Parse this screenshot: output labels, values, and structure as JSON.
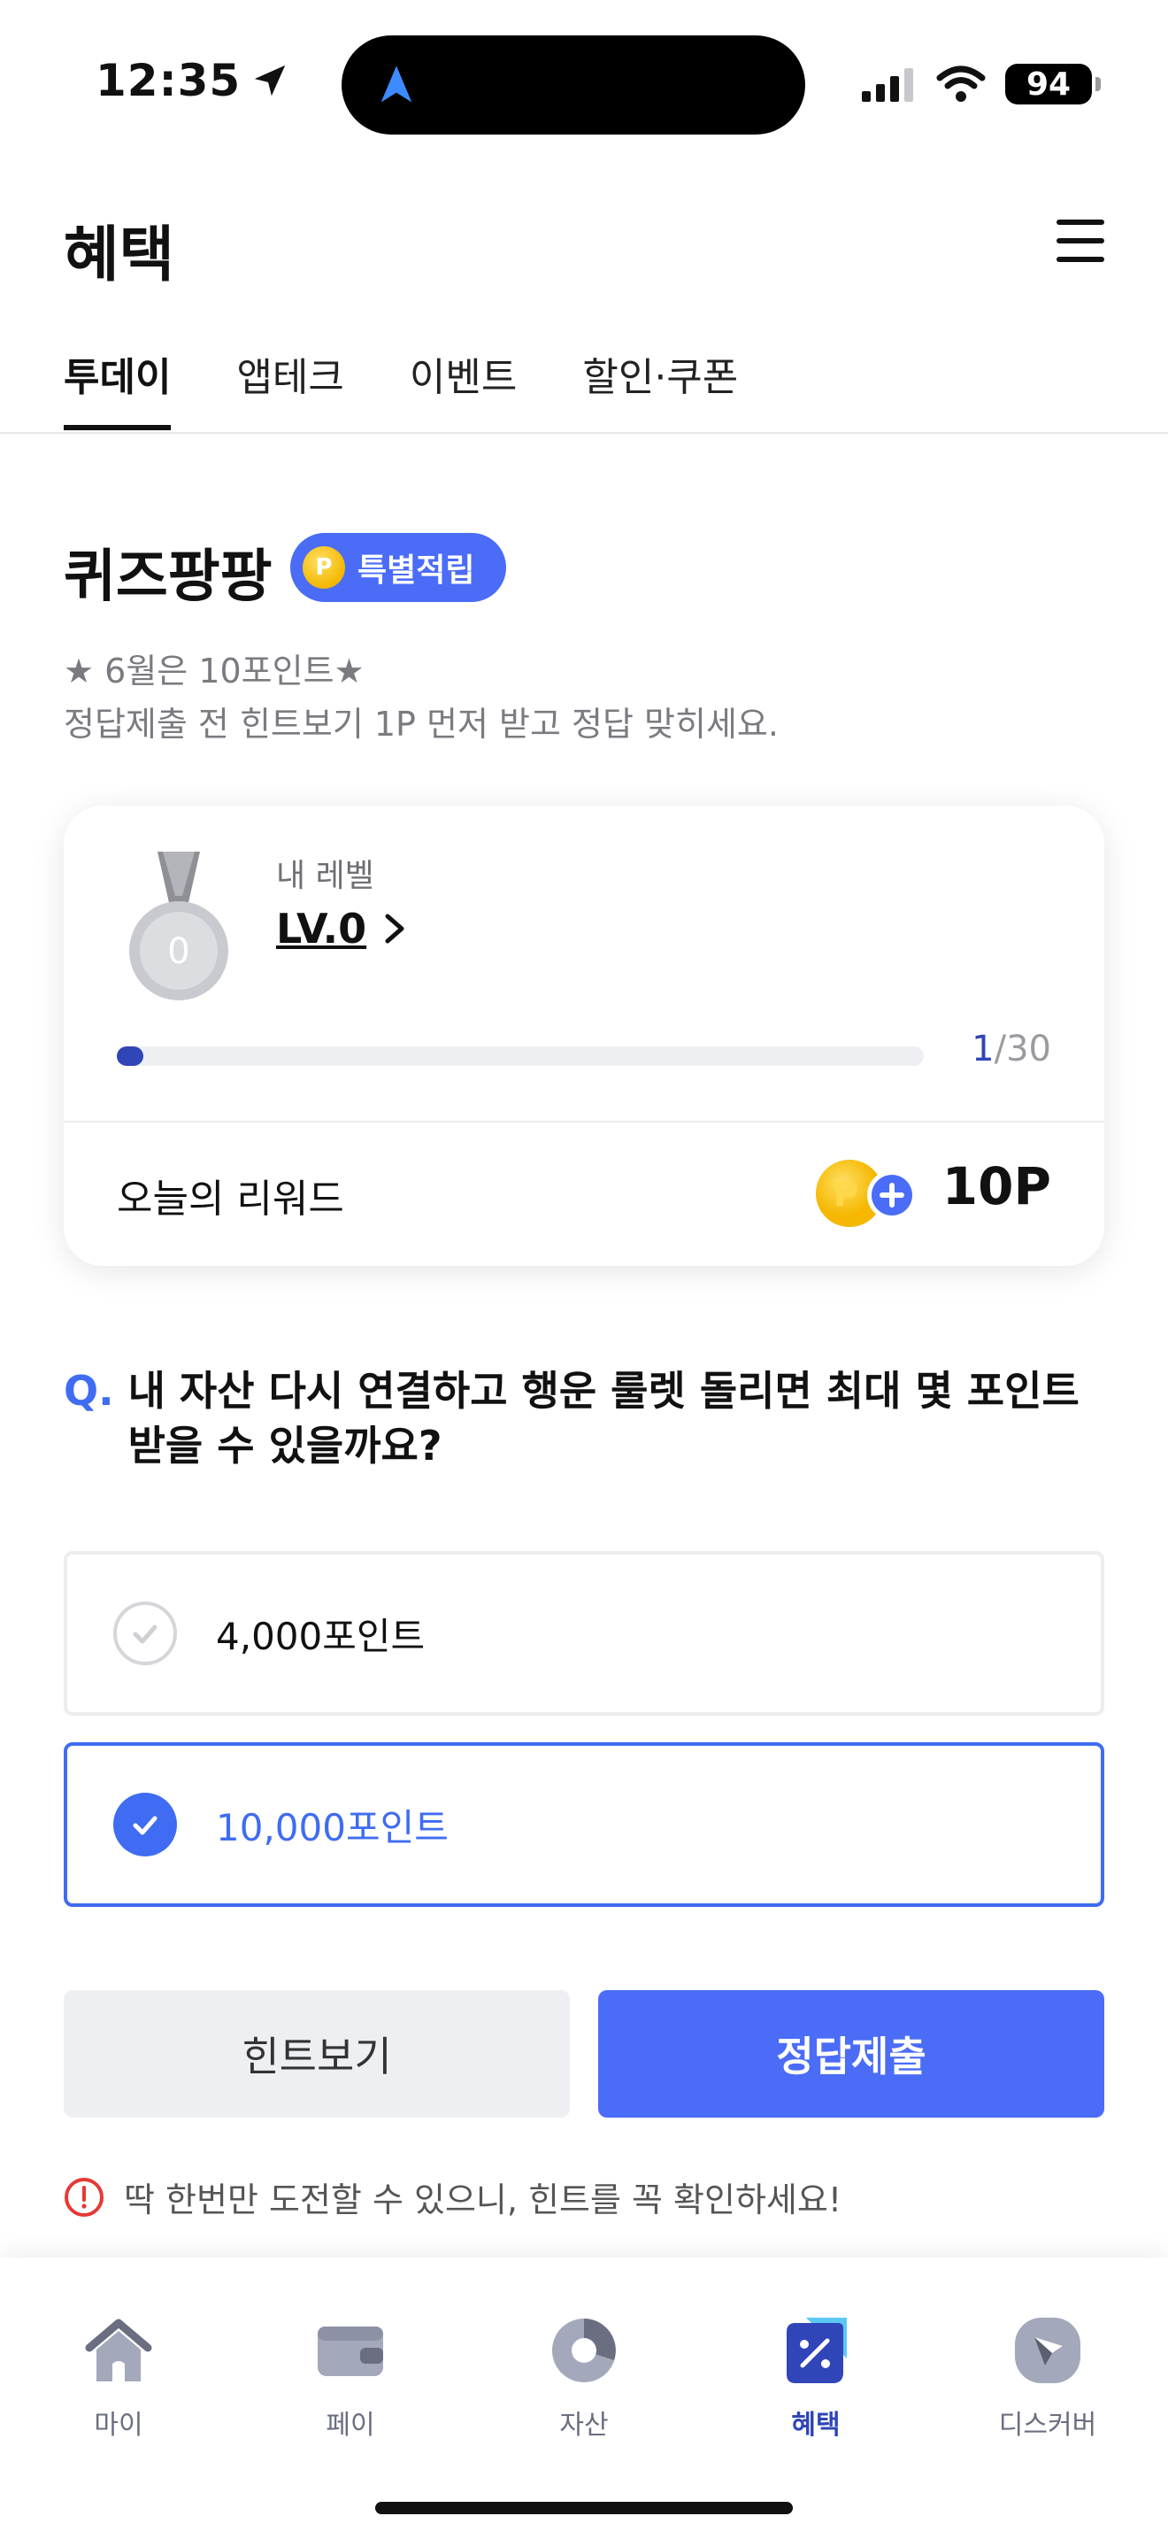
{
  "status_bar": {
    "time": "12:35",
    "battery": "94"
  },
  "header": {
    "title": "혜택"
  },
  "tabs": [
    {
      "label": "투데이",
      "active": true
    },
    {
      "label": "앱테크",
      "active": false
    },
    {
      "label": "이벤트",
      "active": false
    },
    {
      "label": "할인·쿠폰",
      "active": false
    }
  ],
  "quiz": {
    "title": "퀴즈팡팡",
    "badge": "특별적립",
    "badge_coin": "P",
    "desc_line1": "★ 6월은 10포인트★",
    "desc_line2": "정답제출 전 힌트보기 1P 먼저 받고 정답 맞히세요."
  },
  "level_card": {
    "caption": "내 레벨",
    "level": "LV.0",
    "medal_number": "0",
    "progress_current": "1",
    "progress_total": "/30",
    "progress_fraction": 0.0333,
    "reward_label": "오늘의 리워드",
    "reward_amount": "10P"
  },
  "question": {
    "prefix": "Q.",
    "text": "내 자산 다시 연결하고 행운 룰렛 돌리면 최대 몇 포인트 받을 수 있을까요?"
  },
  "options": [
    {
      "label": "4,000포인트",
      "selected": false
    },
    {
      "label": "10,000포인트",
      "selected": true
    }
  ],
  "buttons": {
    "hint": "힌트보기",
    "submit": "정답제출"
  },
  "warning": "딱 한번만 도전할 수 있으니, 힌트를 꼭 확인하세요!",
  "bottom_nav": [
    {
      "label": "마이",
      "icon": "home-icon",
      "active": false
    },
    {
      "label": "페이",
      "icon": "wallet-icon",
      "active": false
    },
    {
      "label": "자산",
      "icon": "pie-chart-icon",
      "active": false
    },
    {
      "label": "혜택",
      "icon": "benefit-tag-icon",
      "active": true
    },
    {
      "label": "디스커버",
      "icon": "compass-icon",
      "active": false
    }
  ],
  "colors": {
    "accent": "#4a6cf7",
    "primary_dark": "#2f45b8",
    "nav_inactive": "#6a6e80"
  }
}
